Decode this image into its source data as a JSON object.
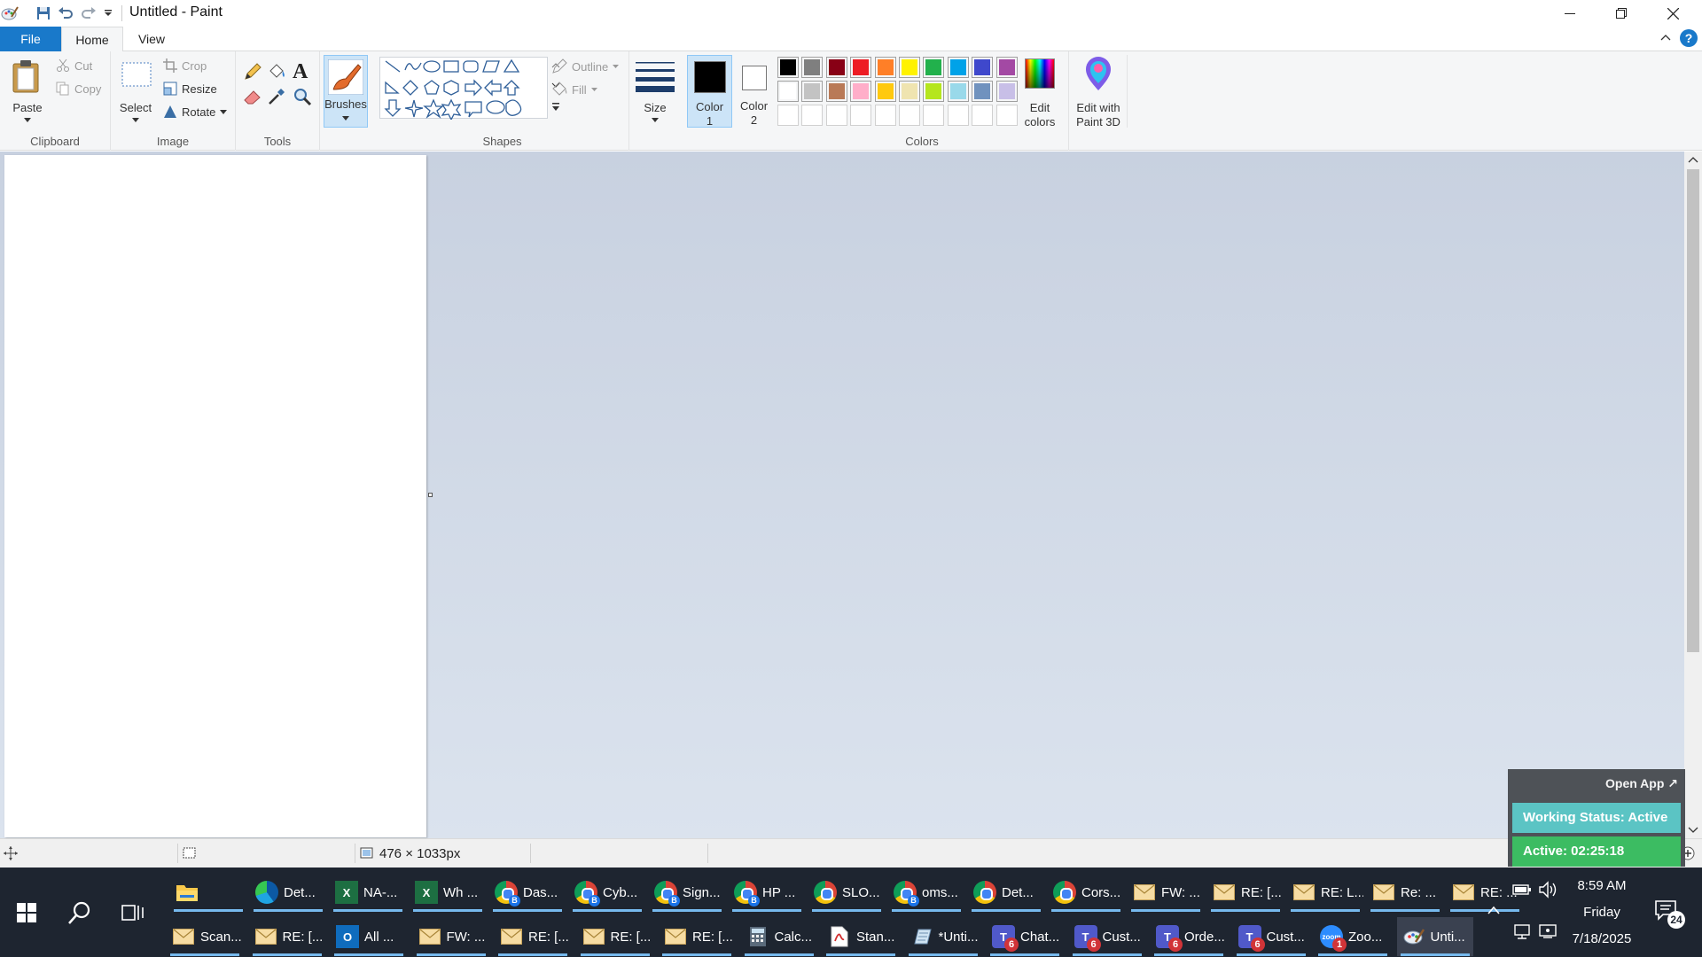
{
  "titlebar": {
    "title": "Untitled - Paint",
    "icons": [
      "paint-app-icon",
      "save-icon",
      "undo-icon",
      "redo-icon",
      "customize-qat-icon"
    ]
  },
  "tabs": {
    "file": "File",
    "home": "Home",
    "view": "View"
  },
  "ribbon": {
    "clipboard": {
      "group": "Clipboard",
      "paste": "Paste",
      "cut": "Cut",
      "copy": "Copy"
    },
    "image": {
      "group": "Image",
      "select": "Select",
      "crop": "Crop",
      "resize": "Resize",
      "rotate": "Rotate"
    },
    "tools": {
      "group": "Tools"
    },
    "brushes": {
      "label": "Brushes"
    },
    "shapes": {
      "group": "Shapes",
      "outline": "Outline",
      "fill": "Fill"
    },
    "size": {
      "label": "Size"
    },
    "color1": {
      "line1": "Color",
      "line2": "1",
      "color": "#000000"
    },
    "color2": {
      "line1": "Color",
      "line2": "2",
      "color": "#ffffff"
    },
    "colors": {
      "group": "Colors",
      "row1": [
        "#000000",
        "#7f7f7f",
        "#880015",
        "#ed1c24",
        "#ff7f27",
        "#fff200",
        "#22b14c",
        "#00a2e8",
        "#3f48cc",
        "#a349a4"
      ],
      "row2": [
        "#ffffff",
        "#c3c3c3",
        "#b97a57",
        "#ffaec9",
        "#ffc90e",
        "#efe4b0",
        "#b5e61d",
        "#99d9ea",
        "#7092be",
        "#c8bfe7"
      ],
      "row3_count": 10
    },
    "edit_colors": {
      "line1": "Edit",
      "line2": "colors"
    },
    "paint3d": {
      "line1": "Edit with",
      "line2": "Paint 3D"
    }
  },
  "statusbar": {
    "canvas_size": "476 × 1033px"
  },
  "widget": {
    "open_app": "Open App ↗",
    "status": "Working Status: Active",
    "active": "Active: 02:25:18"
  },
  "taskbar": {
    "row1": [
      {
        "label": "",
        "icon": "file-explorer-icon",
        "kind": "explorer"
      },
      {
        "label": "Det...",
        "icon": "edge-icon",
        "kind": "edge"
      },
      {
        "label": "NA-...",
        "icon": "excel-icon",
        "kind": "excel"
      },
      {
        "label": "Wh ...",
        "icon": "excel-icon",
        "kind": "excel"
      },
      {
        "label": "Das...",
        "icon": "chrome-icon",
        "kind": "chromeb"
      },
      {
        "label": "Cyb...",
        "icon": "chrome-icon",
        "kind": "chromeb"
      },
      {
        "label": "Sign...",
        "icon": "chrome-icon",
        "kind": "chromeb"
      },
      {
        "label": "HP ...",
        "icon": "chrome-icon",
        "kind": "chromeb"
      },
      {
        "label": "SLO...",
        "icon": "chrome-icon",
        "kind": "chrome"
      },
      {
        "label": "oms...",
        "icon": "chrome-icon",
        "kind": "chromeb"
      },
      {
        "label": "Det...",
        "icon": "chrome-icon",
        "kind": "chrome"
      },
      {
        "label": "Cors...",
        "icon": "chrome-icon",
        "kind": "chrome"
      },
      {
        "label": "FW: ...",
        "icon": "mail-icon",
        "kind": "mail"
      },
      {
        "label": "RE: [...",
        "icon": "mail-icon",
        "kind": "mail"
      },
      {
        "label": "RE: L...",
        "icon": "mail-icon",
        "kind": "mail"
      },
      {
        "label": "Re: ...",
        "icon": "mail-icon",
        "kind": "mail"
      },
      {
        "label": "RE: ...",
        "icon": "mail-icon",
        "kind": "mail"
      }
    ],
    "row2": [
      {
        "label": "Scan...",
        "icon": "mail-icon",
        "kind": "mail"
      },
      {
        "label": "RE: [...",
        "icon": "mail-icon",
        "kind": "mail"
      },
      {
        "label": "All ...",
        "icon": "outlook-icon",
        "kind": "outlook"
      },
      {
        "label": "FW: ...",
        "icon": "mail-icon",
        "kind": "mail"
      },
      {
        "label": "RE: [...",
        "icon": "mail-icon",
        "kind": "mail"
      },
      {
        "label": "RE: [...",
        "icon": "mail-icon",
        "kind": "mail"
      },
      {
        "label": "RE: [...",
        "icon": "mail-icon",
        "kind": "mail"
      },
      {
        "label": "Calc...",
        "icon": "calculator-icon",
        "kind": "calc"
      },
      {
        "label": "Stan...",
        "icon": "pdf-icon",
        "kind": "pdf"
      },
      {
        "label": "*Unti...",
        "icon": "notepad-icon",
        "kind": "notepad"
      },
      {
        "label": "Chat...",
        "icon": "teams-icon",
        "kind": "teams",
        "badge": "6"
      },
      {
        "label": "Cust...",
        "icon": "teams-icon",
        "kind": "teams",
        "badge": "6"
      },
      {
        "label": "Orde...",
        "icon": "teams-icon",
        "kind": "teams",
        "badge": "6"
      },
      {
        "label": "Cust...",
        "icon": "teams-icon",
        "kind": "teams",
        "badge": "6"
      },
      {
        "label": "Zoo...",
        "icon": "zoom-icon",
        "kind": "zoom",
        "badge": "1"
      },
      {
        "label": "Unti...",
        "icon": "paint-icon",
        "kind": "paint",
        "focused": true
      }
    ],
    "time": "8:59 AM",
    "day": "Friday",
    "date": "7/18/2025",
    "notifications": "24"
  }
}
